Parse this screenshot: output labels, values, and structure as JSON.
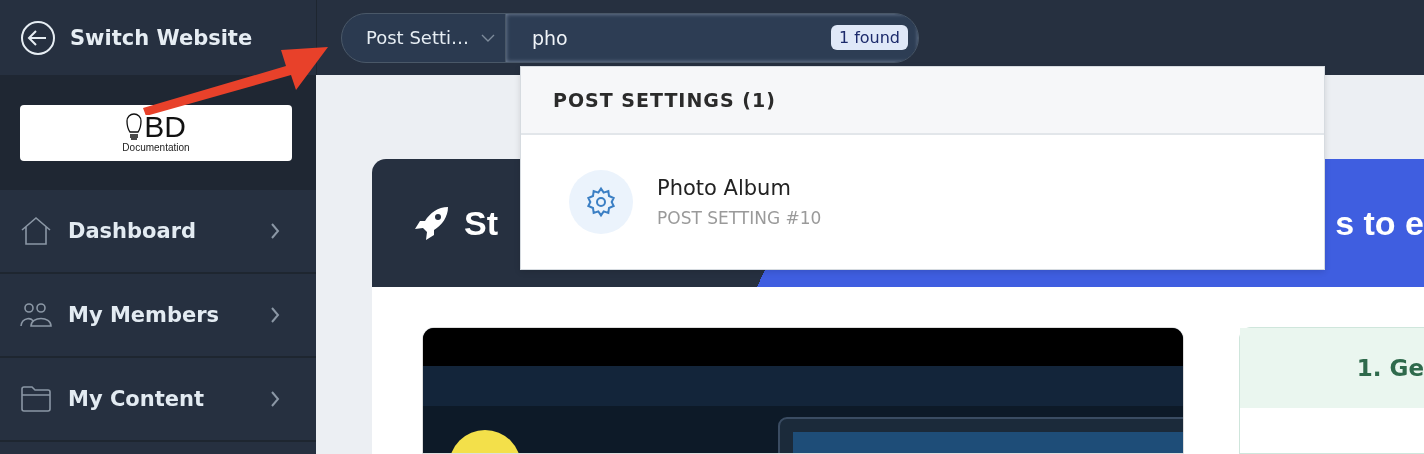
{
  "sidebar": {
    "back": {
      "label": "Switch Website"
    },
    "logo": {
      "mark": "BD",
      "caption": "Documentation"
    },
    "items": [
      {
        "label": "Dashboard"
      },
      {
        "label": "My Members"
      },
      {
        "label": "My Content"
      }
    ]
  },
  "search": {
    "scope": "Post Setti…",
    "value": "pho",
    "count": "1 found"
  },
  "results": {
    "group": "POST SETTINGS (1)",
    "items": [
      {
        "title": "Photo Album",
        "subtitle": "POST SETTING #10"
      }
    ]
  },
  "banner": {
    "title_start": "St",
    "title_end": "s to e"
  },
  "guide": {
    "heading": "1. Ge"
  }
}
